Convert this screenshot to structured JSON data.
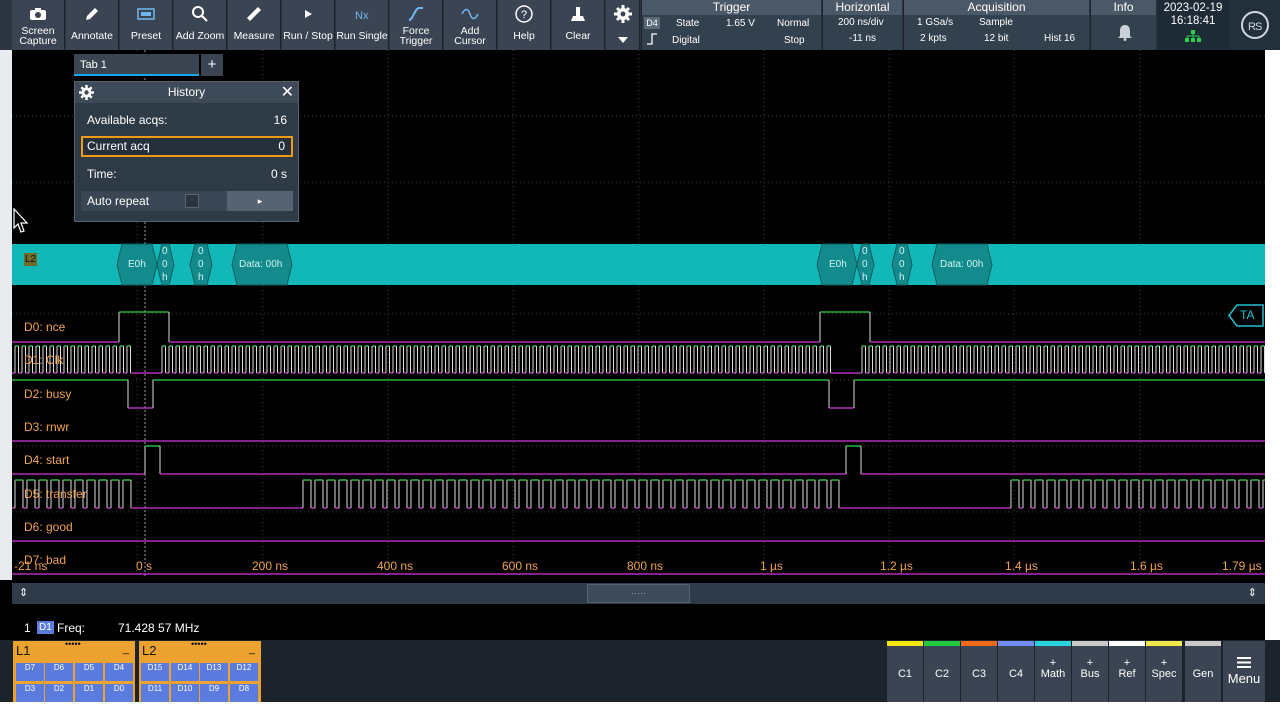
{
  "toolbar": {
    "buttons": [
      {
        "label": "Screen\nCapture",
        "icon": "camera-icon"
      },
      {
        "label": "Annotate",
        "icon": "pencil-icon"
      },
      {
        "label": "Preset",
        "icon": "preset-icon"
      },
      {
        "label": "Add Zoom",
        "icon": "zoom-icon"
      },
      {
        "label": "Measure",
        "icon": "ruler-icon"
      },
      {
        "label": "Run / Stop",
        "icon": "play-icon"
      },
      {
        "label": "Run Single",
        "icon": "run-single-icon"
      },
      {
        "label": "Force\nTrigger",
        "icon": "force-trigger-icon"
      },
      {
        "label": "Add\nCursor",
        "icon": "cursor-icon"
      },
      {
        "label": "Help",
        "icon": "help-icon"
      },
      {
        "label": "Clear",
        "icon": "clear-icon"
      }
    ],
    "more_icon": "gear-icon"
  },
  "trigger": {
    "header": "Trigger",
    "source": "D4",
    "type": "State",
    "level": "1.65 V",
    "mode": "Normal",
    "coupling": "Digital",
    "state": "Stop"
  },
  "horizontal": {
    "header": "Horizontal",
    "scale": "200 ns/div",
    "position": "-11 ns"
  },
  "acquisition": {
    "header": "Acquisition",
    "rate": "1 GSa/s",
    "mode": "Sample",
    "points": "2 kpts",
    "resolution": "12 bit",
    "hist": "Hist 16"
  },
  "info": {
    "header": "Info"
  },
  "datetime": {
    "date": "2023-02-19",
    "time": "16:18:41"
  },
  "tabs": {
    "tab1": "Tab 1",
    "add": "+"
  },
  "history": {
    "title": "History",
    "available_label": "Available acqs:",
    "available_value": "16",
    "current_label": "Current acq",
    "current_value": "0",
    "time_label": "Time:",
    "time_value": "0 s",
    "autorepeat_label": "Auto repeat",
    "play_label": "▸"
  },
  "bus": {
    "name": "L2",
    "frames": [
      {
        "label": "E0h"
      },
      {
        "label": "0 0 h"
      },
      {
        "label": "0 0 h"
      },
      {
        "label": "Data: 00h"
      },
      {
        "label": "E0h"
      },
      {
        "label": "0 0 h"
      },
      {
        "label": "0 0 h"
      },
      {
        "label": "Data: 00h"
      }
    ]
  },
  "channels": [
    "D0: nce",
    "D1: Clk",
    "D2: busy",
    "D3: rnwr",
    "D4: start",
    "D5: transfer",
    "D6: good",
    "D7: bad"
  ],
  "ta_marker": "TA",
  "xaxis": {
    "ticks": [
      "-21 ns",
      "0 s",
      "200 ns",
      "400 ns",
      "600 ns",
      "800 ns",
      "1 µs",
      "1.2 µs",
      "1.4 µs",
      "1.6 µs",
      "1.79 µs"
    ]
  },
  "measurement": {
    "index": "1",
    "source": "D1",
    "name": "Freq:",
    "value": "71.428 57 MHz"
  },
  "logic_groups": [
    {
      "name": "L1",
      "bits_top": [
        "D7",
        "D6",
        "D5",
        "D4"
      ],
      "bits_bottom": [
        "D3",
        "D2",
        "D1",
        "D0"
      ]
    },
    {
      "name": "L2",
      "bits_top": [
        "D15",
        "D14",
        "D13",
        "D12"
      ],
      "bits_bottom": [
        "D11",
        "D10",
        "D9",
        "D8"
      ]
    }
  ],
  "channel_buttons": [
    {
      "label": "C1",
      "color": "#f5e60f"
    },
    {
      "label": "C2",
      "color": "#22c93e"
    },
    {
      "label": "C3",
      "color": "#f06a1a"
    },
    {
      "label": "C4",
      "color": "#6f8cf0"
    },
    {
      "label": "+\nMath",
      "color": "#2bd3e0"
    },
    {
      "label": "+\nBus",
      "color": "#c8c8c8"
    },
    {
      "label": "+\nRef",
      "color": "#ffffff"
    },
    {
      "label": "+\nSpec",
      "color": "#f1e64a"
    },
    {
      "label": "Gen",
      "color": "#c8c8c8"
    }
  ],
  "menu": {
    "label": "Menu"
  }
}
